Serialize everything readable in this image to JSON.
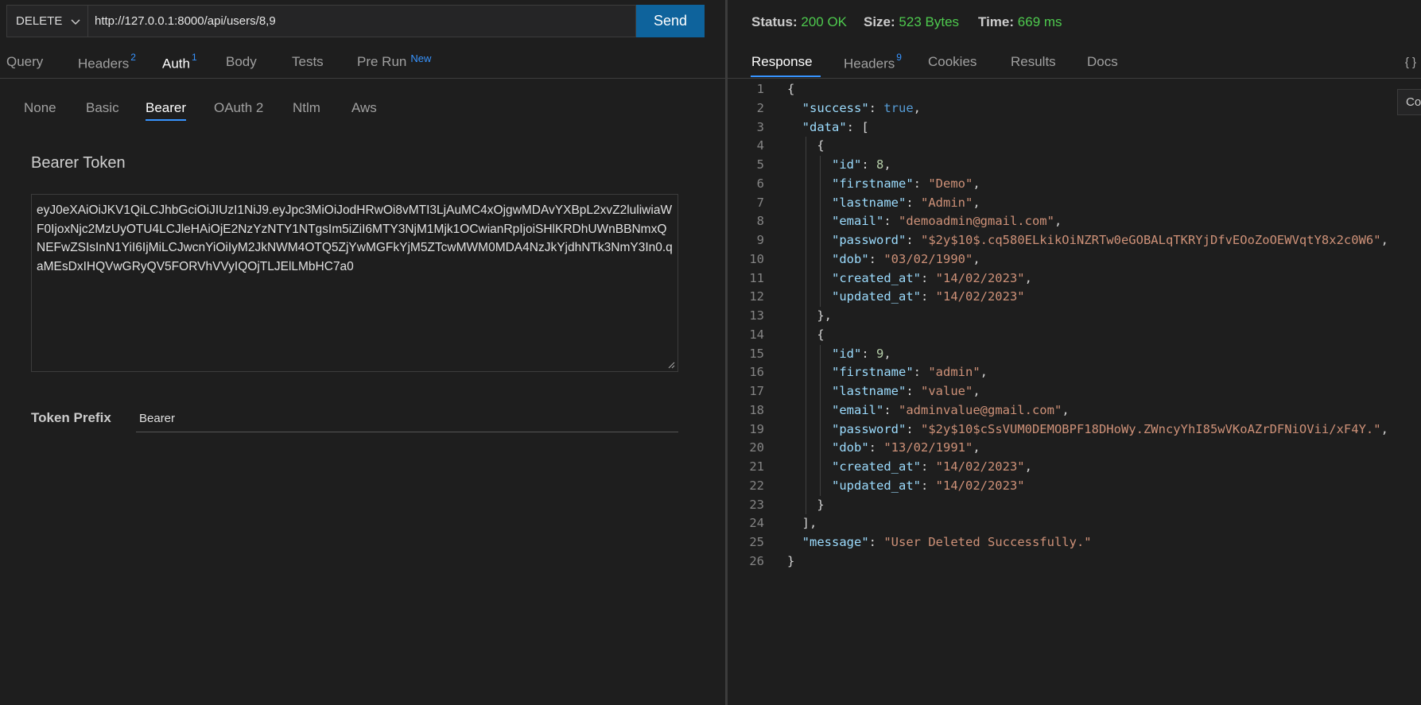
{
  "request": {
    "method": "DELETE",
    "url": "http://127.0.0.1:8000/api/users/8,9",
    "send_label": "Send"
  },
  "request_tabs": [
    {
      "label": "Query",
      "badge": ""
    },
    {
      "label": "Headers",
      "badge": "2"
    },
    {
      "label": "Auth",
      "badge": "1"
    },
    {
      "label": "Body",
      "badge": ""
    },
    {
      "label": "Tests",
      "badge": ""
    },
    {
      "label": "Pre Run",
      "badge": "New"
    }
  ],
  "auth_tabs": [
    "None",
    "Basic",
    "Bearer",
    "OAuth 2",
    "Ntlm",
    "Aws"
  ],
  "auth": {
    "section_title": "Bearer Token",
    "token": "eyJ0eXAiOiJKV1QiLCJhbGciOiJIUzI1NiJ9.eyJpc3MiOiJodHRwOi8vMTI3LjAuMC4xOjgwMDAvYXBpL2xvZ2luliwiaWF0IjoxNjc2MzUyOTU4LCJleHAiOjE2NzYzNTY1NTgsIm5iZiI6MTY3NjM1Mjk1OCwianRpIjoiSHlKRDhUWnBBNmxQNEFwZSIsInN1YiI6IjMiLCJwcnYiOiIyM2JkNWM4OTQ5ZjYwMGFkYjM5ZTcwMWM0MDA4NzJkYjdhNTk3NmY3In0.qaMEsDxIHQVwGRyQV5FORVhVVyIQOjTLJElLMbHC7a0",
    "prefix_label": "Token Prefix",
    "prefix_value": "Bearer"
  },
  "status": {
    "status_label": "Status:",
    "status_value": "200 OK",
    "size_label": "Size:",
    "size_value": "523 Bytes",
    "time_label": "Time:",
    "time_value": "669 ms"
  },
  "response_tabs": [
    {
      "label": "Response",
      "badge": ""
    },
    {
      "label": "Headers",
      "badge": "9"
    },
    {
      "label": "Cookies",
      "badge": ""
    },
    {
      "label": "Results",
      "badge": ""
    },
    {
      "label": "Docs",
      "badge": ""
    }
  ],
  "format_icon": "{ }",
  "copy_label": "Co",
  "colors": {
    "accent": "#3794ff",
    "send_button": "#0e639c",
    "status_ok": "#4ec94e",
    "json_key": "#9cdcfe",
    "json_string": "#ce9178",
    "json_number": "#b5cea8",
    "json_bool": "#569cd6"
  },
  "response_lines": [
    "{",
    "  \"success\": true,",
    "  \"data\": [",
    "    {",
    "      \"id\": 8,",
    "      \"firstname\": \"Demo\",",
    "      \"lastname\": \"Admin\",",
    "      \"email\": \"demoadmin@gmail.com\",",
    "      \"password\": \"$2y$10$.cq580ELkikOiNZRTw0eGOBALqTKRYjDfvEOoZoOEWVqtY8x2c0W6\",",
    "      \"dob\": \"03/02/1990\",",
    "      \"created_at\": \"14/02/2023\",",
    "      \"updated_at\": \"14/02/2023\"",
    "    },",
    "    {",
    "      \"id\": 9,",
    "      \"firstname\": \"admin\",",
    "      \"lastname\": \"value\",",
    "      \"email\": \"adminvalue@gmail.com\",",
    "      \"password\": \"$2y$10$cSsVUM0DEMOBPF18DHoWy.ZWncyYhI85wVKoAZrDFNiOVii/xF4Y.\",",
    "      \"dob\": \"13/02/1991\",",
    "      \"created_at\": \"14/02/2023\",",
    "      \"updated_at\": \"14/02/2023\"",
    "    }",
    "  ],",
    "  \"message\": \"User Deleted Successfully.\"",
    "}"
  ]
}
